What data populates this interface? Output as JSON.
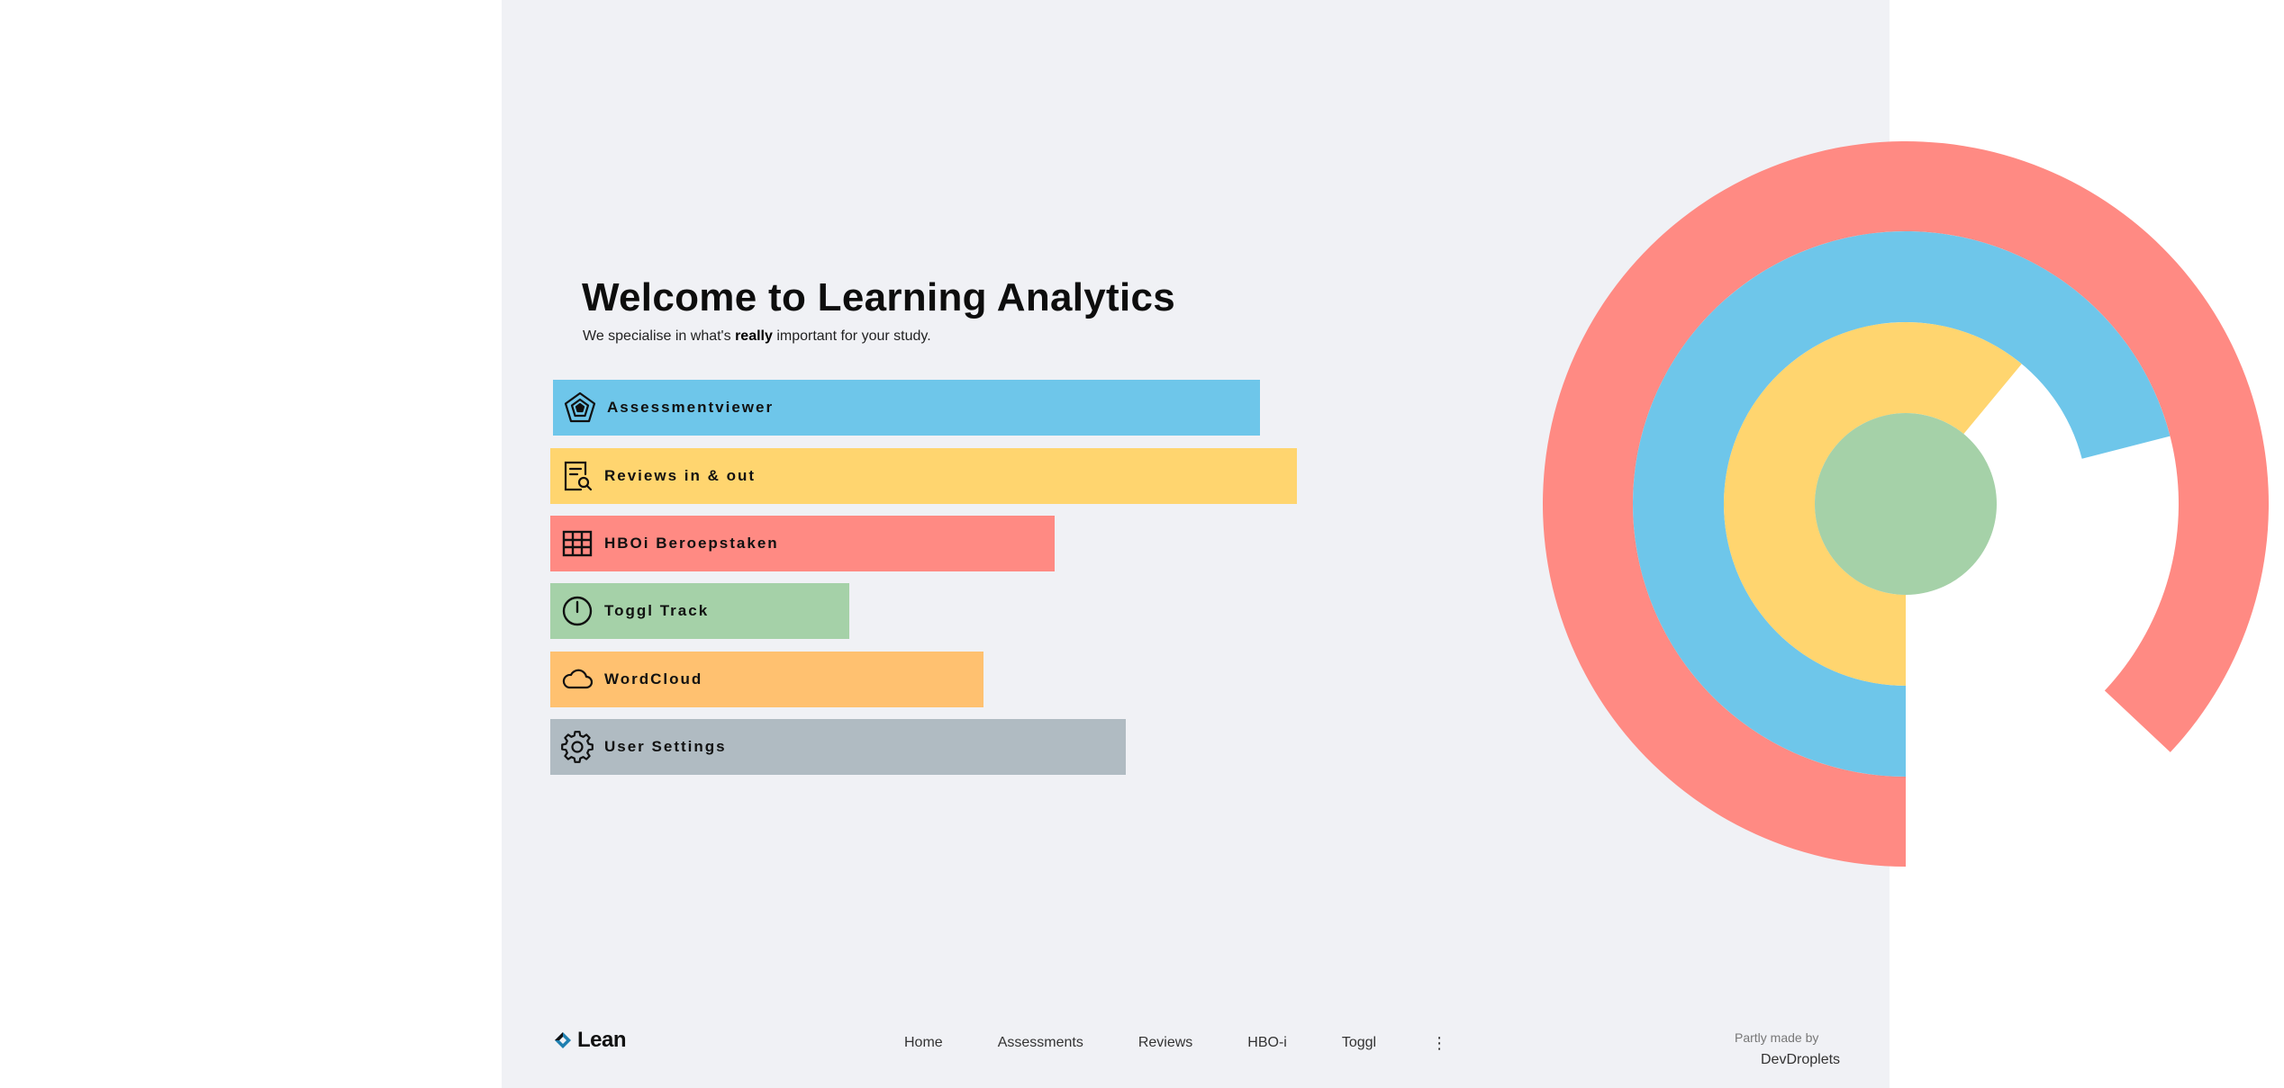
{
  "hero": {
    "title": "Welcome to Learning Analytics",
    "subtitle_before": "We specialise in what's ",
    "subtitle_emphasis": "really",
    "subtitle_after": " important for your study."
  },
  "menu": [
    {
      "label": "Assessmentviewer",
      "icon": "pentagon-web-icon",
      "color": "#6ec6ea",
      "level": 0.77
    },
    {
      "label": "Reviews in & out",
      "icon": "document-search-icon",
      "color": "#ffd56f",
      "level": 0.82
    },
    {
      "label": "HBOi Beroepstaken",
      "icon": "grid-table-icon",
      "color": "#ff8a83",
      "level": 0.56
    },
    {
      "label": "Toggl Track",
      "icon": "power-icon",
      "color": "#a5d1a8",
      "level": 0.33
    },
    {
      "label": "WordCloud",
      "icon": "cloud-icon",
      "color": "#ffc170",
      "level": 0.48
    },
    {
      "label": "User Settings",
      "icon": "gear-icon",
      "color": "#b0bbc2",
      "level": 0.64
    }
  ],
  "footer": {
    "brand": "Lean",
    "nav": [
      "Home",
      "Assessments",
      "Reviews",
      "HBO-i",
      "Toggl"
    ],
    "more_icon": "vertical-dots-icon",
    "credit_top": "Partly made by",
    "credit_bottom": "DevDroplets"
  },
  "radial": {
    "rings": [
      {
        "color": "#ff8a83",
        "fraction": 0.87
      },
      {
        "color": "#6ec6ea",
        "fraction": 0.71
      },
      {
        "color": "#ffd56f",
        "fraction": 0.61
      },
      {
        "color": "#a5d1a8",
        "fraction": 1.0
      }
    ]
  }
}
